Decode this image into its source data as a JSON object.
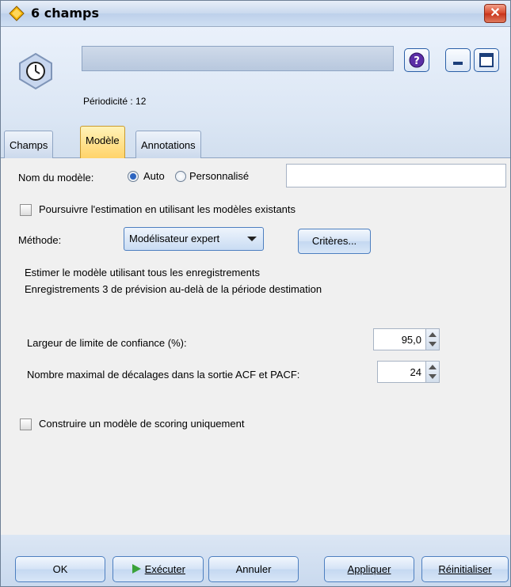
{
  "window": {
    "title": "6 champs",
    "close_glyph": "✕"
  },
  "header": {
    "node_name_value": "",
    "periodicity": "Périodicité : 12",
    "help_glyph": "?"
  },
  "tabs": [
    {
      "label": "Champs"
    },
    {
      "label": "Modèle",
      "active": true
    },
    {
      "label": "Annotations"
    }
  ],
  "model": {
    "name_label": "Nom du modèle:",
    "auto_label": "Auto",
    "custom_label": "Personnalisé",
    "name_value": "",
    "continue_label": "Poursuivre l'estimation en utilisant les modèles existants",
    "method_label": "Méthode:",
    "method_value": "Modélisateur expert",
    "criteria_button": "Critères...",
    "info_line1": "Estimer le modèle utilisant tous les enregistrements",
    "info_line2": "Enregistrements 3 de prévision au-delà de la période destimation",
    "confidence_label": "Largeur de limite de confiance (%):",
    "confidence_value": "95,0",
    "lags_label": "Nombre maximal de décalages dans la sortie ACF et PACF:",
    "lags_value": "24",
    "scoring_label": "Construire un modèle de scoring uniquement"
  },
  "footer": {
    "ok": "OK",
    "run": "Exécuter",
    "cancel": "Annuler",
    "apply": "Appliquer",
    "reset": "Réinitialiser"
  },
  "colors": {
    "accent": "#2c64c0",
    "active_tab": "#ffd36a",
    "run_icon": "#3aa23a"
  }
}
